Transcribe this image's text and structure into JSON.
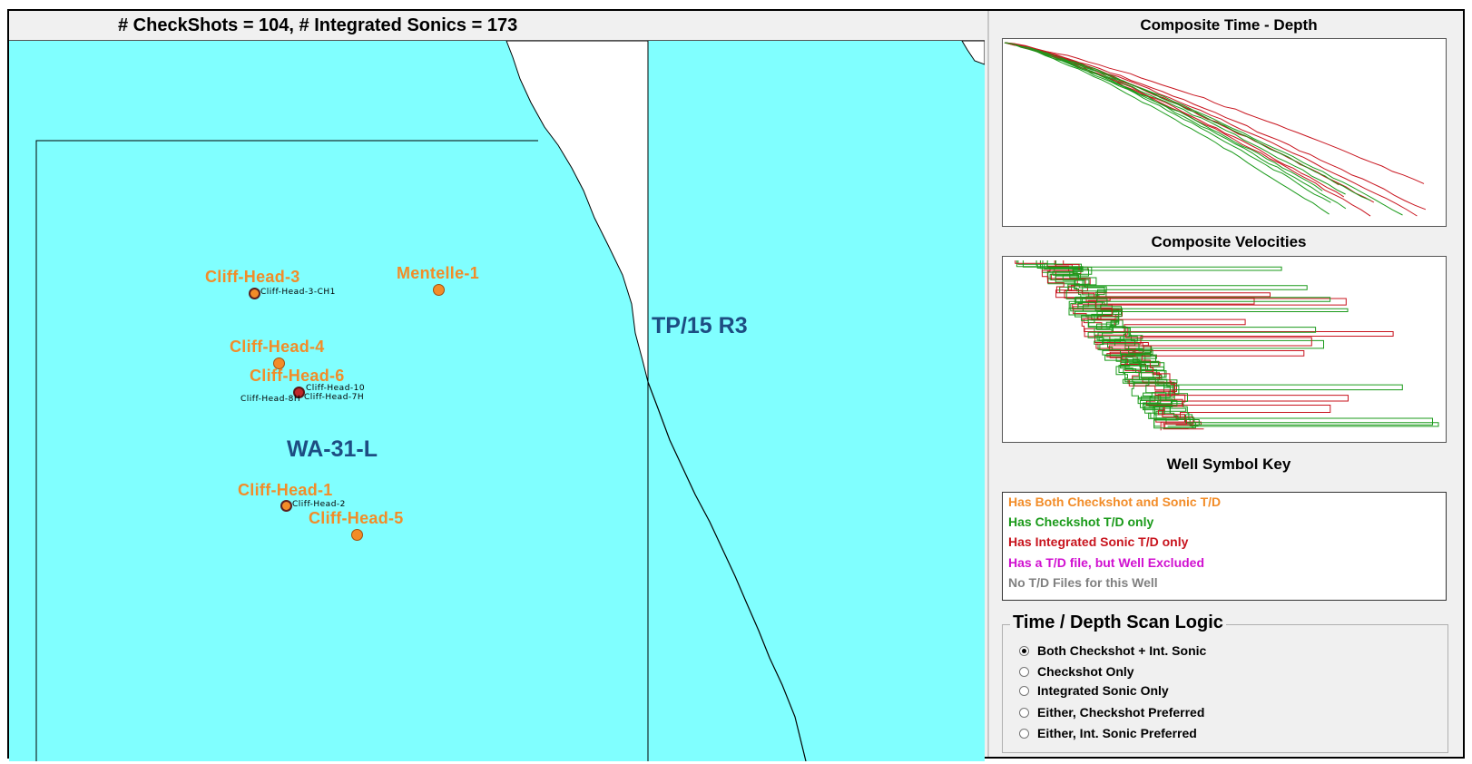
{
  "header": {
    "title": "# CheckShots = 104,  # Integrated Sonics = 173"
  },
  "map": {
    "regions": [
      {
        "label": "WA-31-L"
      },
      {
        "label": "TP/15 R3"
      }
    ],
    "wells": [
      {
        "name": "Cliff-Head-3",
        "sub_label": "Cliff-Head-3-CH1"
      },
      {
        "name": "Mentelle-1"
      },
      {
        "name": "Cliff-Head-4"
      },
      {
        "name": "Cliff-Head-6",
        "sub_labels": [
          "Cliff-Head-10",
          "Cliff-Head-7H",
          "Cliff-Head-8H"
        ]
      },
      {
        "name": "Cliff-Head-1",
        "sub_label": "Cliff-Head-2"
      },
      {
        "name": "Cliff-Head-5"
      }
    ],
    "colors": {
      "sea": "#80ffff",
      "land": "#ffffff",
      "well_label": "#f28c28",
      "region_label": "#1d4d82"
    }
  },
  "time_depth": {
    "title": "Composite Time - Depth"
  },
  "velocities": {
    "title": "Composite Velocities"
  },
  "key": {
    "title": "Well Symbol Key",
    "items": [
      {
        "label": "Has Both Checkshot and Sonic T/D",
        "color": "#f28c28"
      },
      {
        "label": "Has Checkshot T/D only",
        "color": "#1a9a1a"
      },
      {
        "label": "Has Integrated Sonic T/D only",
        "color": "#c8141e"
      },
      {
        "label": "Has a T/D file, but Well Excluded",
        "color": "#d010d0"
      },
      {
        "label": "No T/D Files for this Well",
        "color": "#808080"
      }
    ]
  },
  "scan_logic": {
    "title": "Time / Depth Scan Logic",
    "options": [
      {
        "label": "Both Checkshot + Int. Sonic",
        "checked": true
      },
      {
        "label": "Checkshot Only",
        "checked": false
      },
      {
        "label": "Integrated Sonic Only",
        "checked": false
      },
      {
        "label": "Either, Checkshot Preferred",
        "checked": false
      },
      {
        "label": "Either, Int. Sonic Preferred",
        "checked": false
      }
    ]
  },
  "series_colors": {
    "checkshot": "#1a9a1a",
    "sonic": "#c8141e"
  }
}
